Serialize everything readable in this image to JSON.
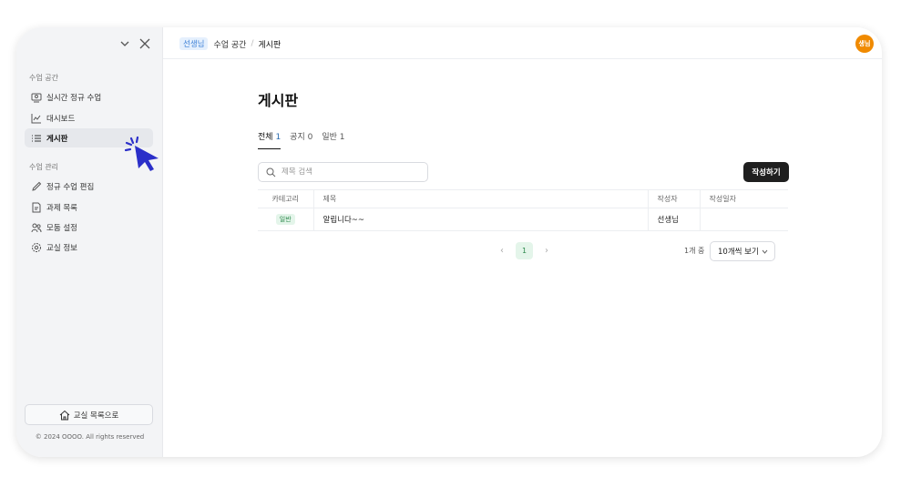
{
  "sidebar": {
    "section1_label": "수업 공간",
    "section1_items": [
      {
        "label": "실시간 정규 수업",
        "icon": "live-class-icon"
      },
      {
        "label": "대시보드",
        "icon": "dashboard-icon"
      },
      {
        "label": "게시판",
        "icon": "list-icon",
        "active": true
      }
    ],
    "section2_label": "수업 관리",
    "section2_items": [
      {
        "label": "정규 수업 편집",
        "icon": "pencil-icon"
      },
      {
        "label": "과제 목록",
        "icon": "document-icon"
      },
      {
        "label": "모둠 설정",
        "icon": "group-icon"
      },
      {
        "label": "교실 정보",
        "icon": "gear-icon"
      }
    ],
    "back_button": "교실 목록으로",
    "copyright": "© 2024 OOOO. All rights reserved"
  },
  "header": {
    "badge": "선생님",
    "crumb_parent": "수업 공간",
    "crumb_separator": "/",
    "crumb_current": "게시판",
    "avatar": "생님",
    "avatar_color": "#f08a00"
  },
  "main": {
    "title": "게시판",
    "tabs": [
      {
        "label": "전체",
        "count": "1",
        "active": true
      },
      {
        "label": "공지",
        "count": "0"
      },
      {
        "label": "일반",
        "count": "1"
      }
    ],
    "search_placeholder": "제목 검색",
    "write_button": "작성하기",
    "table": {
      "headers": [
        "카테고리",
        "제목",
        "작성자",
        "작성일자"
      ],
      "rows": [
        {
          "category": "일반",
          "title": "알립니다~~",
          "author": "선생님",
          "date": ""
        }
      ]
    },
    "pagination": {
      "prev": "‹",
      "current": "1",
      "next": "›"
    },
    "per_page_label": "1개 중",
    "per_page_value": "10개씩 보기"
  },
  "colors": {
    "accent_dark": "#1f1f1f",
    "badge_blue": "#3b7fd6",
    "badge_green": "#2f8a4e",
    "cursor": "#2b2fc9"
  }
}
